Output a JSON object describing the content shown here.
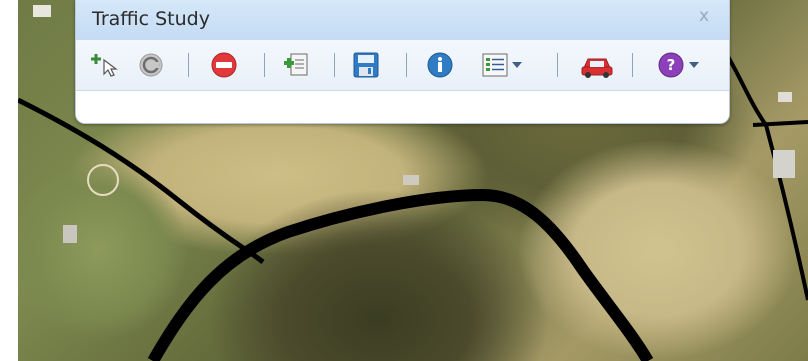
{
  "panel": {
    "title": "Traffic Study",
    "close_glyph": "x"
  },
  "toolbar": {
    "tools": [
      {
        "icon": "add-point-cursor-icon"
      },
      {
        "icon": "copyright-circle-icon"
      },
      {
        "icon": "no-entry-icon"
      },
      {
        "icon": "add-document-icon"
      },
      {
        "icon": "save-disk-icon"
      },
      {
        "icon": "info-icon"
      },
      {
        "icon": "list-dropdown-icon"
      },
      {
        "icon": "car-icon"
      },
      {
        "icon": "help-dropdown-icon"
      }
    ]
  },
  "colors": {
    "titlebar": "#c9def4",
    "toolbar": "#eef4fa",
    "road": "#000000"
  }
}
